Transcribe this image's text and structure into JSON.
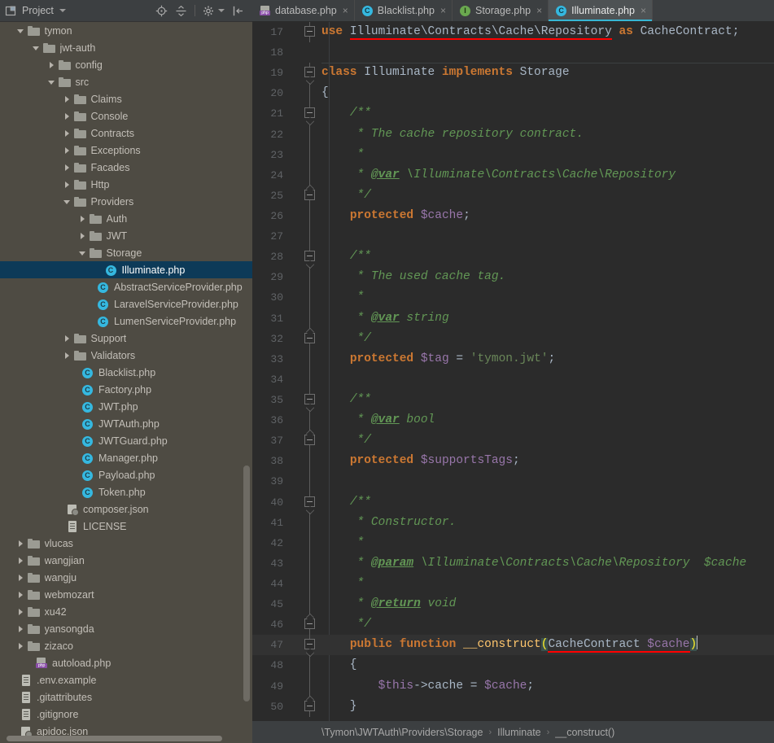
{
  "project_panel": {
    "title": "Project",
    "toolbar_icons": [
      "locate-icon",
      "collapse-all-icon",
      "settings-gear-icon",
      "hide-panel-icon"
    ],
    "tree": [
      {
        "label": "tymon",
        "depth": 1,
        "icon": "folder",
        "twist": "open",
        "selected": false
      },
      {
        "label": "jwt-auth",
        "depth": 2,
        "icon": "folder",
        "twist": "open",
        "selected": false
      },
      {
        "label": "config",
        "depth": 3,
        "icon": "folder",
        "twist": "closed",
        "selected": false
      },
      {
        "label": "src",
        "depth": 3,
        "icon": "folder",
        "twist": "open",
        "selected": false
      },
      {
        "label": "Claims",
        "depth": 4,
        "icon": "folder",
        "twist": "closed",
        "selected": false
      },
      {
        "label": "Console",
        "depth": 4,
        "icon": "folder",
        "twist": "closed",
        "selected": false
      },
      {
        "label": "Contracts",
        "depth": 4,
        "icon": "folder",
        "twist": "closed",
        "selected": false
      },
      {
        "label": "Exceptions",
        "depth": 4,
        "icon": "folder",
        "twist": "closed",
        "selected": false
      },
      {
        "label": "Facades",
        "depth": 4,
        "icon": "folder",
        "twist": "closed",
        "selected": false
      },
      {
        "label": "Http",
        "depth": 4,
        "icon": "folder",
        "twist": "closed",
        "selected": false
      },
      {
        "label": "Providers",
        "depth": 4,
        "icon": "folder",
        "twist": "open",
        "selected": false
      },
      {
        "label": "Auth",
        "depth": 5,
        "icon": "folder",
        "twist": "closed",
        "selected": false
      },
      {
        "label": "JWT",
        "depth": 5,
        "icon": "folder",
        "twist": "closed",
        "selected": false
      },
      {
        "label": "Storage",
        "depth": 5,
        "icon": "folder",
        "twist": "open",
        "selected": false
      },
      {
        "label": "Illuminate.php",
        "depth": 6,
        "icon": "phpclass",
        "twist": "none",
        "selected": true
      },
      {
        "label": "AbstractServiceProvider.php",
        "depth": 5.5,
        "icon": "phpclass",
        "twist": "none",
        "selected": false
      },
      {
        "label": "LaravelServiceProvider.php",
        "depth": 5.5,
        "icon": "phpclass",
        "twist": "none",
        "selected": false
      },
      {
        "label": "LumenServiceProvider.php",
        "depth": 5.5,
        "icon": "phpclass",
        "twist": "none",
        "selected": false
      },
      {
        "label": "Support",
        "depth": 4,
        "icon": "folder",
        "twist": "closed",
        "selected": false
      },
      {
        "label": "Validators",
        "depth": 4,
        "icon": "folder",
        "twist": "closed",
        "selected": false
      },
      {
        "label": "Blacklist.php",
        "depth": 4.5,
        "icon": "phpclass",
        "twist": "none",
        "selected": false
      },
      {
        "label": "Factory.php",
        "depth": 4.5,
        "icon": "phpclass",
        "twist": "none",
        "selected": false
      },
      {
        "label": "JWT.php",
        "depth": 4.5,
        "icon": "phpclass",
        "twist": "none",
        "selected": false
      },
      {
        "label": "JWTAuth.php",
        "depth": 4.5,
        "icon": "phpclass",
        "twist": "none",
        "selected": false
      },
      {
        "label": "JWTGuard.php",
        "depth": 4.5,
        "icon": "phpclass",
        "twist": "none",
        "selected": false
      },
      {
        "label": "Manager.php",
        "depth": 4.5,
        "icon": "phpclass",
        "twist": "none",
        "selected": false
      },
      {
        "label": "Payload.php",
        "depth": 4.5,
        "icon": "phpclass",
        "twist": "none",
        "selected": false
      },
      {
        "label": "Token.php",
        "depth": 4.5,
        "icon": "phpclass",
        "twist": "none",
        "selected": false
      },
      {
        "label": "composer.json",
        "depth": 3.5,
        "icon": "json",
        "twist": "none",
        "selected": false
      },
      {
        "label": "LICENSE",
        "depth": 3.5,
        "icon": "doc",
        "twist": "none",
        "selected": false
      },
      {
        "label": "vlucas",
        "depth": 1,
        "icon": "folder",
        "twist": "closed",
        "selected": false
      },
      {
        "label": "wangjian",
        "depth": 1,
        "icon": "folder",
        "twist": "closed",
        "selected": false
      },
      {
        "label": "wangju",
        "depth": 1,
        "icon": "folder",
        "twist": "closed",
        "selected": false
      },
      {
        "label": "webmozart",
        "depth": 1,
        "icon": "folder",
        "twist": "closed",
        "selected": false
      },
      {
        "label": "xu42",
        "depth": 1,
        "icon": "folder",
        "twist": "closed",
        "selected": false
      },
      {
        "label": "yansongda",
        "depth": 1,
        "icon": "folder",
        "twist": "closed",
        "selected": false
      },
      {
        "label": "zizaco",
        "depth": 1,
        "icon": "folder",
        "twist": "closed",
        "selected": false
      },
      {
        "label": "autoload.php",
        "depth": 1.5,
        "icon": "phpfile",
        "twist": "none",
        "selected": false
      },
      {
        "label": ".env.example",
        "depth": 0.5,
        "icon": "doc",
        "twist": "none",
        "selected": false
      },
      {
        "label": ".gitattributes",
        "depth": 0.5,
        "icon": "doc",
        "twist": "none",
        "selected": false
      },
      {
        "label": ".gitignore",
        "depth": 0.5,
        "icon": "doc",
        "twist": "none",
        "selected": false
      },
      {
        "label": "apidoc.json",
        "depth": 0.5,
        "icon": "json",
        "twist": "none",
        "selected": false
      }
    ]
  },
  "tabs": [
    {
      "label": "database.php",
      "icon": "php-file-icon",
      "active": false,
      "close": "×"
    },
    {
      "label": "Blacklist.php",
      "icon": "php-class-icon",
      "active": false,
      "close": "×"
    },
    {
      "label": "Storage.php",
      "icon": "php-interface-icon",
      "active": false,
      "close": "×"
    },
    {
      "label": "Illuminate.php",
      "icon": "php-class-icon",
      "active": true,
      "close": "×"
    }
  ],
  "editor": {
    "first_line": 17,
    "lines": [
      {
        "n": 17,
        "fold": "top",
        "indent": 0,
        "hl": false,
        "text": "use Illuminate\\Contracts\\Cache\\Repository as CacheContract;"
      },
      {
        "n": 18,
        "fold": "none",
        "indent": 0,
        "hl": false,
        "text": ""
      },
      {
        "n": 19,
        "fold": "topd",
        "indent": 0,
        "hl": false,
        "text": "class Illuminate implements Storage"
      },
      {
        "n": 20,
        "fold": "line",
        "indent": 0,
        "hl": false,
        "text": "{"
      },
      {
        "n": 21,
        "fold": "topd",
        "indent": 1,
        "hl": false,
        "text": "/**"
      },
      {
        "n": 22,
        "fold": "line",
        "indent": 1,
        "hl": false,
        "text": " * The cache repository contract."
      },
      {
        "n": 23,
        "fold": "line",
        "indent": 1,
        "hl": false,
        "text": " *"
      },
      {
        "n": 24,
        "fold": "line",
        "indent": 1,
        "hl": false,
        "text": " * @var \\Illuminate\\Contracts\\Cache\\Repository"
      },
      {
        "n": 25,
        "fold": "bot",
        "indent": 1,
        "hl": false,
        "text": " */"
      },
      {
        "n": 26,
        "fold": "line",
        "indent": 1,
        "hl": false,
        "text": "protected $cache;"
      },
      {
        "n": 27,
        "fold": "line",
        "indent": 0,
        "hl": false,
        "text": ""
      },
      {
        "n": 28,
        "fold": "topd",
        "indent": 1,
        "hl": false,
        "text": "/**"
      },
      {
        "n": 29,
        "fold": "line",
        "indent": 1,
        "hl": false,
        "text": " * The used cache tag."
      },
      {
        "n": 30,
        "fold": "line",
        "indent": 1,
        "hl": false,
        "text": " *"
      },
      {
        "n": 31,
        "fold": "line",
        "indent": 1,
        "hl": false,
        "text": " * @var string"
      },
      {
        "n": 32,
        "fold": "bot",
        "indent": 1,
        "hl": false,
        "text": " */"
      },
      {
        "n": 33,
        "fold": "line",
        "indent": 1,
        "hl": false,
        "text": "protected $tag = 'tymon.jwt';"
      },
      {
        "n": 34,
        "fold": "line",
        "indent": 0,
        "hl": false,
        "text": ""
      },
      {
        "n": 35,
        "fold": "topd",
        "indent": 1,
        "hl": false,
        "text": "/**"
      },
      {
        "n": 36,
        "fold": "line",
        "indent": 1,
        "hl": false,
        "text": " * @var bool"
      },
      {
        "n": 37,
        "fold": "bot",
        "indent": 1,
        "hl": false,
        "text": " */"
      },
      {
        "n": 38,
        "fold": "line",
        "indent": 1,
        "hl": false,
        "text": "protected $supportsTags;"
      },
      {
        "n": 39,
        "fold": "line",
        "indent": 0,
        "hl": false,
        "text": ""
      },
      {
        "n": 40,
        "fold": "topd",
        "indent": 1,
        "hl": false,
        "text": "/**"
      },
      {
        "n": 41,
        "fold": "line",
        "indent": 1,
        "hl": false,
        "text": " * Constructor."
      },
      {
        "n": 42,
        "fold": "line",
        "indent": 1,
        "hl": false,
        "text": " *"
      },
      {
        "n": 43,
        "fold": "line",
        "indent": 1,
        "hl": false,
        "text": " * @param \\Illuminate\\Contracts\\Cache\\Repository  $cache"
      },
      {
        "n": 44,
        "fold": "line",
        "indent": 1,
        "hl": false,
        "text": " *"
      },
      {
        "n": 45,
        "fold": "line",
        "indent": 1,
        "hl": false,
        "text": " * @return void"
      },
      {
        "n": 46,
        "fold": "bot",
        "indent": 1,
        "hl": false,
        "text": " */"
      },
      {
        "n": 47,
        "fold": "topd",
        "indent": 1,
        "hl": true,
        "text": "public function __construct(CacheContract $cache)"
      },
      {
        "n": 48,
        "fold": "line",
        "indent": 1,
        "hl": false,
        "text": "{"
      },
      {
        "n": 49,
        "fold": "line",
        "indent": 2,
        "hl": false,
        "text": "$this->cache = $cache;"
      },
      {
        "n": 50,
        "fold": "bot",
        "indent": 1,
        "hl": false,
        "text": "}"
      }
    ]
  },
  "breadcrumb": {
    "items": [
      "\\Tymon\\JWTAuth\\Providers\\Storage",
      "Illuminate",
      "__construct()"
    ],
    "separator": "›"
  },
  "colors": {
    "keyword": "#cc7832",
    "comment": "#629755",
    "string": "#6a8759",
    "variable": "#9876aa",
    "identifier": "#a9b7c6",
    "editor_bg": "#2b2b2b",
    "panel_bg": "#4e4b43",
    "chrome_bg": "#3c3f41",
    "selection": "#0d3a58",
    "error_underline": "#ff0000",
    "active_tab_underline": "#37b6d4"
  }
}
